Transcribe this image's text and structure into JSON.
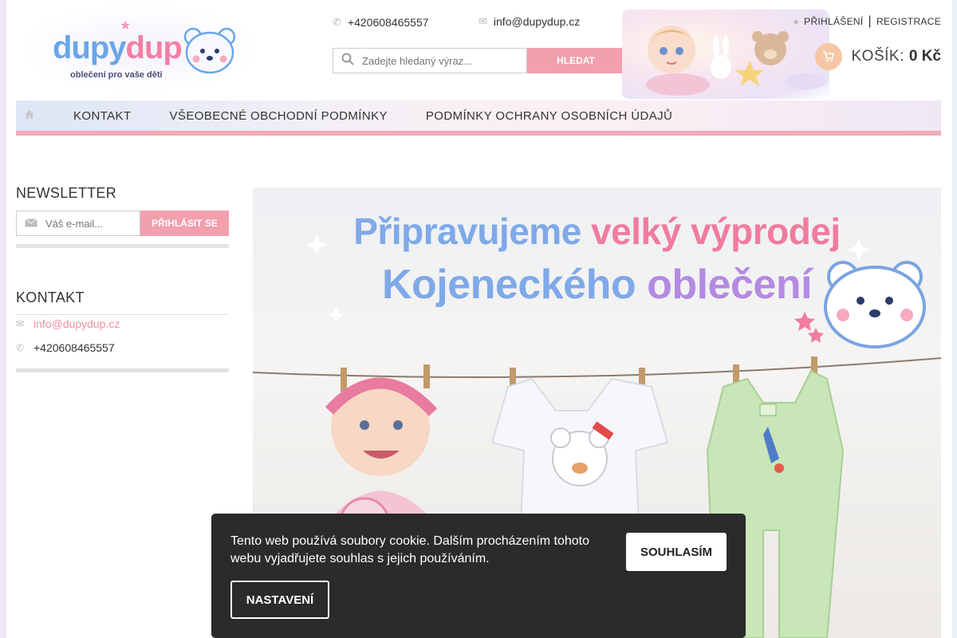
{
  "header": {
    "logo": {
      "word_part1": "dupy",
      "word_part2": "dup",
      "tagline": "oblečení pro vaše děti"
    },
    "phone": "+420608465557",
    "email": "info@dupydup.cz",
    "search": {
      "placeholder": "Zadejte hledaný výraz...",
      "button_label": "HLEDAT"
    },
    "login_label": "PŘIHLÁŠENÍ",
    "separator": "|",
    "register_label": "REGISTRACE",
    "cart": {
      "label": "KOŠÍK:",
      "value": "0 Kč"
    }
  },
  "nav": {
    "items": [
      {
        "label": "KONTAKT"
      },
      {
        "label": "VŠEOBECNÉ OBCHODNÍ PODMÍNKY"
      },
      {
        "label": "PODMÍNKY OCHRANY OSOBNÍCH ÚDAJŮ"
      }
    ]
  },
  "sidebar": {
    "newsletter": {
      "title": "NEWSLETTER",
      "placeholder": "Váš e-mail...",
      "button_label": "PŘIHLÁSIT SE"
    },
    "contact": {
      "title": "KONTAKT",
      "email": "info@dupydup.cz",
      "phone": "+420608465557"
    }
  },
  "banner": {
    "line1_a": "Připravujeme",
    "line1_b": "velký výprodej",
    "line2_a": "Kojeneckého",
    "line2_b": "oblečení"
  },
  "cookie": {
    "text": "Tento web používá soubory cookie. Dalším procházením tohoto webu vyjadřujete souhlas s jejich používáním.",
    "agree_label": "SOUHLASÍM",
    "settings_label": "NASTAVENÍ"
  },
  "colors": {
    "accent_pink": "#f29fae",
    "link_pink": "#f18fa3",
    "logo_blue": "#6aa6e8",
    "dark_panel": "#2b2b2b"
  },
  "icons": [
    "phone-icon",
    "envelope-icon",
    "search-icon",
    "user-icon",
    "cart-icon",
    "home-icon",
    "mail-icon"
  ]
}
